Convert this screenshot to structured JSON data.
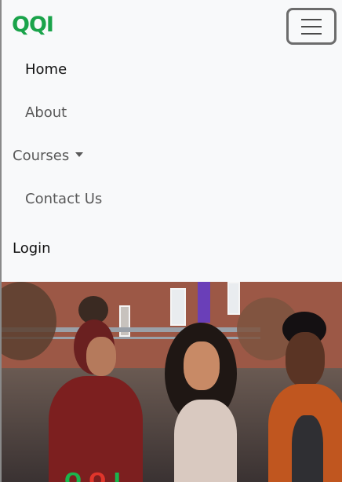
{
  "brand": {
    "part1": "QQ",
    "part2": "",
    "part3": "I"
  },
  "nav": {
    "home": "Home",
    "about": "About",
    "courses": "Courses",
    "contact": "Contact Us",
    "login": "Login"
  },
  "hero": {
    "heading_part1": "Q",
    "heading_part2": "Q",
    "heading_part3": "I"
  },
  "colors": {
    "brand_green": "#1aa34a",
    "brand_red": "#e0352b",
    "navbar_bg": "#f8f9fa"
  },
  "icons": {
    "toggler": "hamburger-menu-icon",
    "dropdown": "caret-down-icon"
  }
}
